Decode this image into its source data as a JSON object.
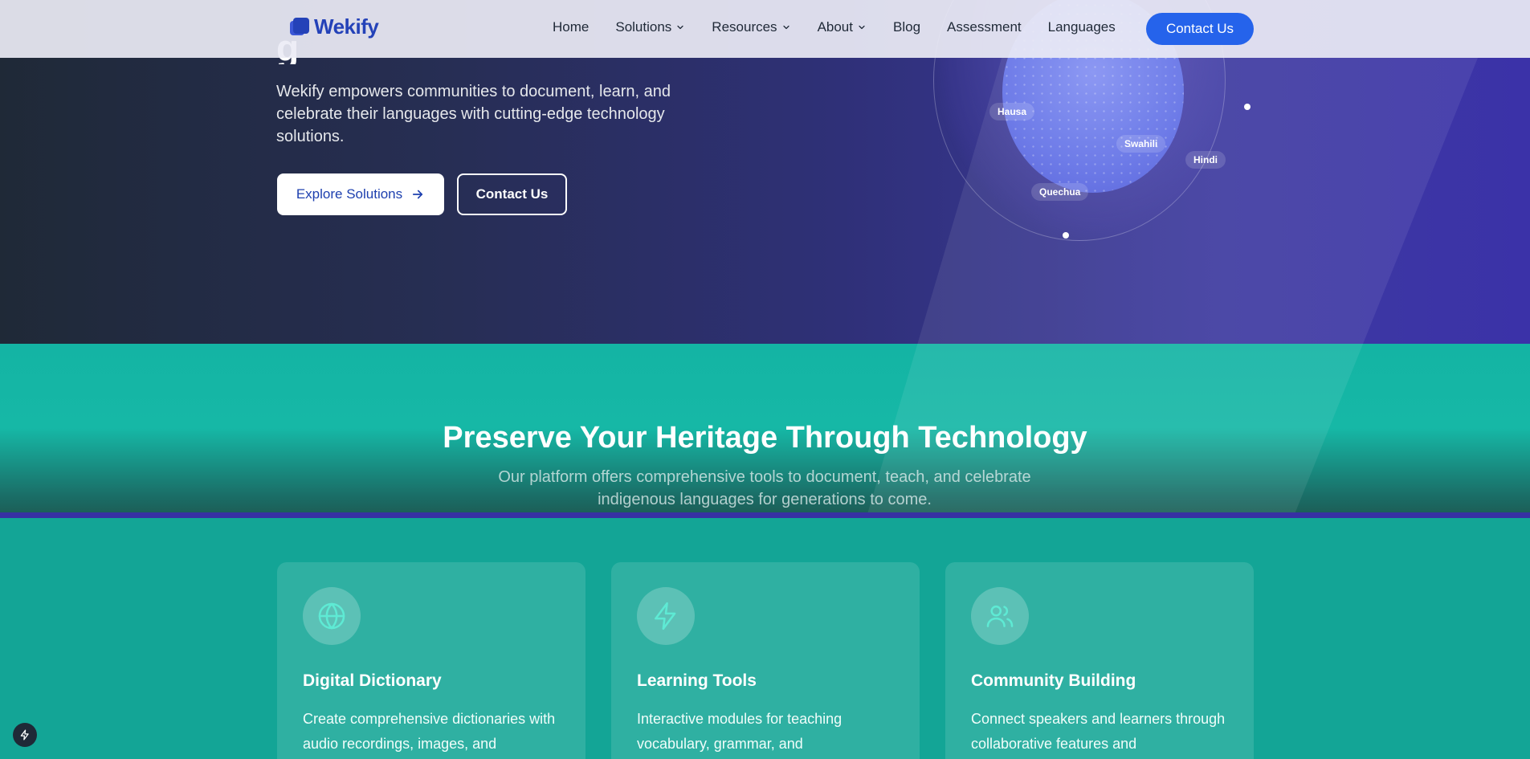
{
  "brand": {
    "name": "Wekify"
  },
  "nav": {
    "items": [
      {
        "label": "Home",
        "dropdown": false
      },
      {
        "label": "Solutions",
        "dropdown": true
      },
      {
        "label": "Resources",
        "dropdown": true
      },
      {
        "label": "About",
        "dropdown": true
      },
      {
        "label": "Blog",
        "dropdown": false
      },
      {
        "label": "Assessment",
        "dropdown": false
      },
      {
        "label": "Languages",
        "dropdown": false
      }
    ],
    "cta_label": "Contact Us"
  },
  "hero": {
    "heading_fragment": "g",
    "subtitle": "Wekify empowers communities to document, learn, and celebrate their languages with cutting-edge technology solutions.",
    "explore_label": "Explore Solutions",
    "contact_label": "Contact Us",
    "languages": [
      "Hausa",
      "Swahili",
      "Hindi",
      "Quechua"
    ]
  },
  "features": {
    "title": "Preserve Your Heritage Through Technology",
    "subtitle": "Our platform offers comprehensive tools to document, teach, and celebrate indigenous languages for generations to come.",
    "cards": [
      {
        "icon": "globe-icon",
        "title": "Digital Dictionary",
        "description": "Create comprehensive dictionaries with audio recordings, images, and"
      },
      {
        "icon": "lightning-icon",
        "title": "Learning Tools",
        "description": "Interactive modules for teaching vocabulary, grammar, and"
      },
      {
        "icon": "users-icon",
        "title": "Community Building",
        "description": "Connect speakers and learners through collaborative features and"
      }
    ]
  },
  "colors": {
    "brand": "#2442b8",
    "cta": "#2563eb",
    "teal": "#14b8a6",
    "icon_teal": "#5eead4",
    "hero_dark": "#1f2937",
    "hero_purple": "#3b32a8"
  }
}
